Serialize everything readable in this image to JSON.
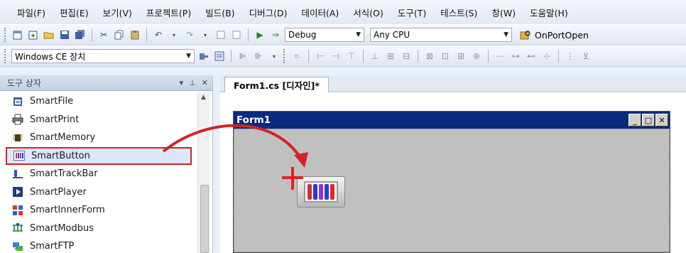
{
  "menubar": {
    "items": [
      "파일(F)",
      "편집(E)",
      "보기(V)",
      "프로젝트(P)",
      "빌드(B)",
      "디버그(D)",
      "데이터(A)",
      "서식(O)",
      "도구(T)",
      "테스트(S)",
      "창(W)",
      "도움말(H)"
    ]
  },
  "toolbar1": {
    "config_value": "Debug",
    "platform_value": "Any CPU",
    "find_value": "OnPortOpen"
  },
  "toolbar2": {
    "device_value": "Windows CE 장치"
  },
  "toolbox": {
    "title": "도구 상자",
    "items": [
      {
        "label": "SmartFile",
        "icon": "smartfile-icon"
      },
      {
        "label": "SmartPrint",
        "icon": "printer-icon"
      },
      {
        "label": "SmartMemory",
        "icon": "memory-chip-icon"
      },
      {
        "label": "SmartButton",
        "icon": "smartbutton-icon"
      },
      {
        "label": "SmartTrackBar",
        "icon": "trackbar-icon"
      },
      {
        "label": "SmartPlayer",
        "icon": "player-icon"
      },
      {
        "label": "SmartInnerForm",
        "icon": "innerform-icon"
      },
      {
        "label": "SmartModbus",
        "icon": "modbus-icon"
      },
      {
        "label": "SmartFTP",
        "icon": "ftp-icon"
      }
    ],
    "selected_index": 3
  },
  "designer": {
    "tab_label": "Form1.cs [디자인]*",
    "form_title": "Form1"
  },
  "colors": {
    "form_titlebar": "#0a2a80",
    "form_client": "#c0c0c0",
    "highlight_border": "#d0242b",
    "drag_arrow": "#d0242b"
  }
}
